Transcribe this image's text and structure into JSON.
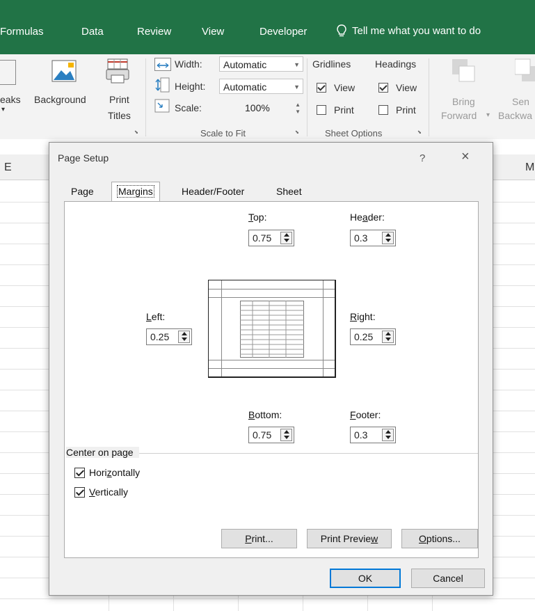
{
  "ribbon_tabs": [
    "Formulas",
    "Data",
    "Review",
    "View",
    "Developer"
  ],
  "tell_me": "Tell me what you want to do",
  "ribbon": {
    "breaks_label": "eaks",
    "background_label": "Background",
    "print_titles_line1": "Print",
    "print_titles_line2": "Titles",
    "width_label": "Width:",
    "width_value": "Automatic",
    "height_label": "Height:",
    "height_value": "Automatic",
    "scale_label": "Scale:",
    "scale_value": "100%",
    "scale_group": "Scale to Fit",
    "gridlines": "Gridlines",
    "headings": "Headings",
    "gridlines_view": "View",
    "gridlines_print": "Print",
    "headings_view": "View",
    "headings_print": "Print",
    "sheet_options_group": "Sheet Options",
    "bring_forward_line1": "Bring",
    "bring_forward_line2": "Forward",
    "send_backward_line1": "Sen",
    "send_backward_line2": "Backwa"
  },
  "columns": {
    "left": "E",
    "right": "M"
  },
  "dialog": {
    "title": "Page Setup",
    "help": "?",
    "close": "×",
    "tabs": [
      "Page",
      "Margins",
      "Header/Footer",
      "Sheet"
    ],
    "active_tab": "Margins",
    "top_label": "Top:",
    "top_value": "0.75",
    "header_label": "Header:",
    "header_value": "0.3",
    "left_label": "Left:",
    "left_value": "0.25",
    "right_label": "Right:",
    "right_value": "0.25",
    "bottom_label": "Bottom:",
    "bottom_value": "0.75",
    "footer_label": "Footer:",
    "footer_value": "0.3",
    "center_group": "Center on page",
    "horizontally": "Horizontally",
    "vertically": "Vertically",
    "print_btn": "Print...",
    "print_preview_btn": "Print Preview",
    "options_btn": "Options...",
    "ok_btn": "OK",
    "cancel_btn": "Cancel"
  },
  "colors": {
    "excel_green": "#217346",
    "accent_blue": "#0078d7"
  }
}
